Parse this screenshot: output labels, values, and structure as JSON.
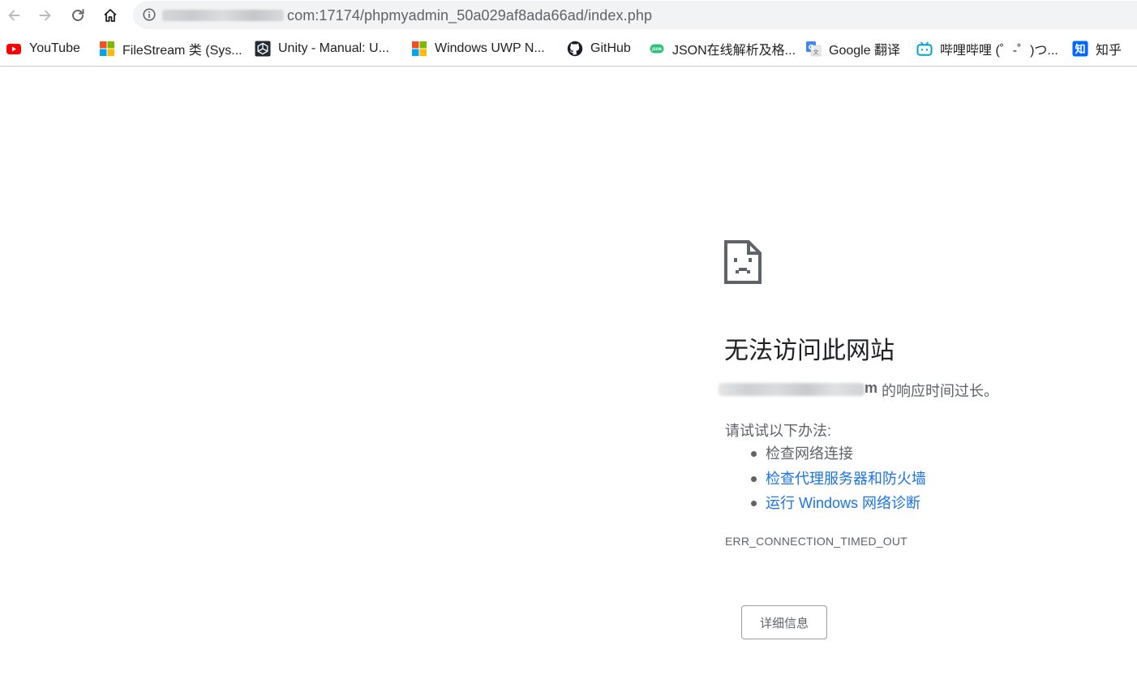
{
  "browser": {
    "url_visible": "com:17174/phpmyadmin_50a029af8ada66ad/index.php",
    "nav": {
      "back_icon": "arrow-left-icon",
      "forward_icon": "arrow-right-icon",
      "reload_icon": "reload-icon",
      "home_icon": "home-icon"
    }
  },
  "bookmarks": [
    {
      "label": "YouTube",
      "icon": "youtube-icon"
    },
    {
      "label": "FileStream 类 (Sys...",
      "icon": "windows-logo-icon"
    },
    {
      "label": "Unity - Manual: U...",
      "icon": "unity-icon"
    },
    {
      "label": "Windows UWP N...",
      "icon": "windows-logo-icon"
    },
    {
      "label": "GitHub",
      "icon": "github-icon"
    },
    {
      "label": "JSON在线解析及格...",
      "icon": "json-icon"
    },
    {
      "label": "Google 翻译",
      "icon": "google-translate-icon"
    },
    {
      "label": "哔哩哔哩 (゜-゜)つ...",
      "icon": "bilibili-icon"
    },
    {
      "label": "知乎",
      "icon": "zhihu-icon"
    }
  ],
  "error": {
    "title": "无法访问此网站",
    "host_end": "m",
    "host_message": "的响应时间过长。",
    "try_label": "请试试以下办法:",
    "suggestions": [
      {
        "text": "检查网络连接",
        "link": false
      },
      {
        "text": "检查代理服务器和防火墙",
        "link": true
      },
      {
        "text": "运行 Windows 网络诊断",
        "link": true
      }
    ],
    "code": "ERR_CONNECTION_TIMED_OUT",
    "details_button": "详细信息"
  },
  "colors": {
    "link": "#1a73e8",
    "text_secondary": "#5f6368",
    "text_primary": "#202124",
    "omnibox_bg": "#f1f3f4"
  }
}
